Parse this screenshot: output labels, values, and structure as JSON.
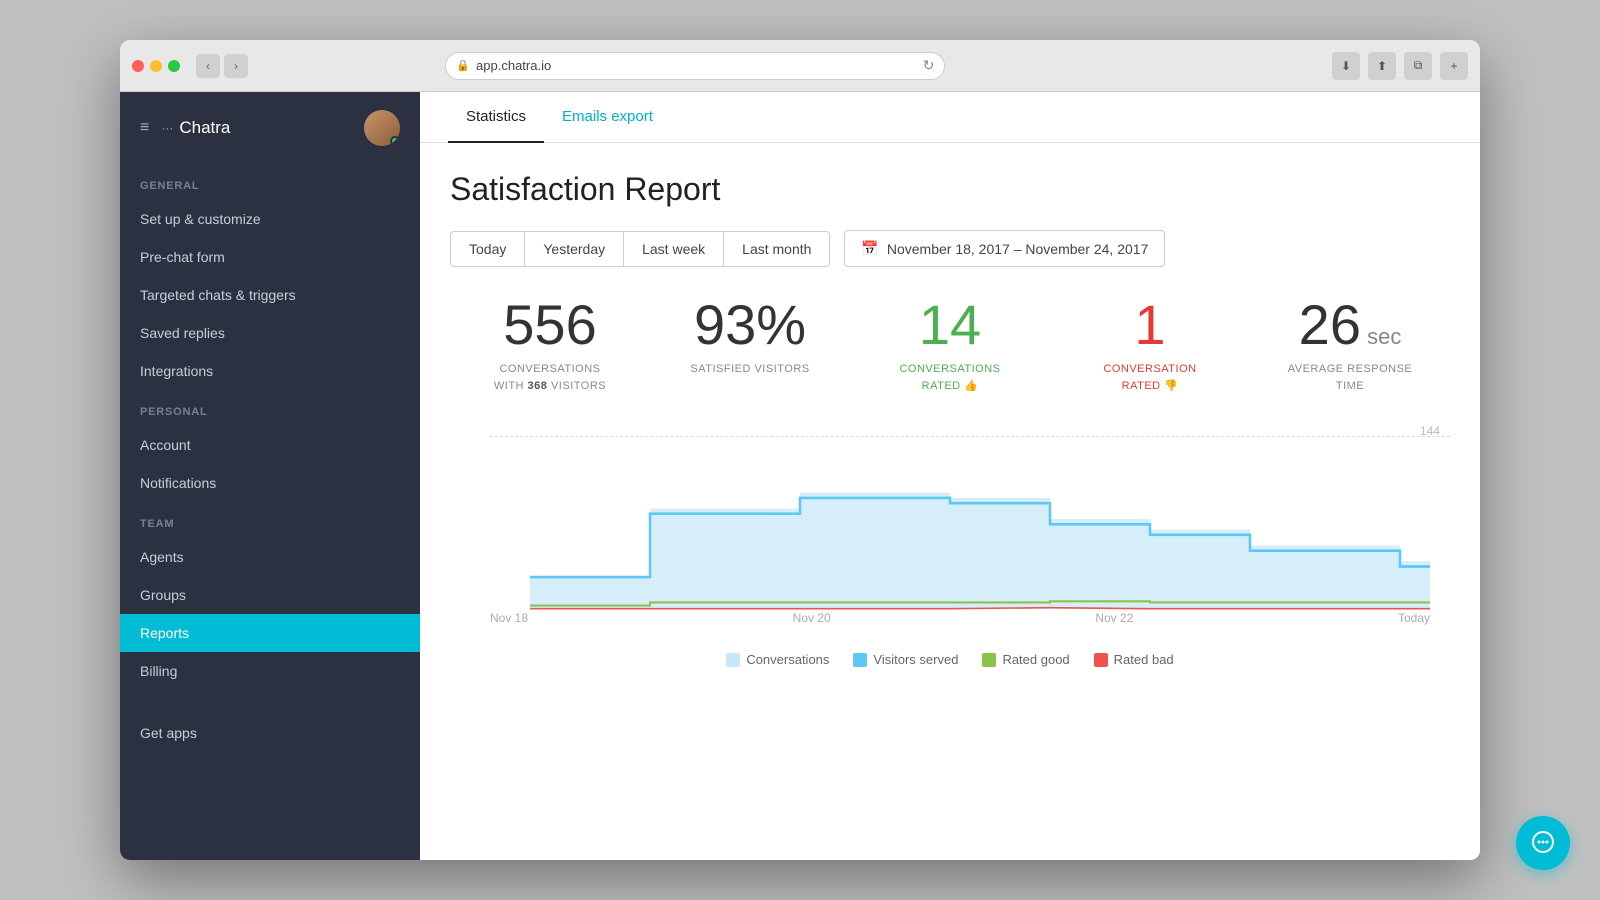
{
  "browser": {
    "url": "app.chatra.io",
    "reload_icon": "↻"
  },
  "sidebar": {
    "app_name": "Chatra",
    "sections": [
      {
        "label": "GENERAL",
        "items": [
          {
            "id": "setup",
            "label": "Set up & customize",
            "active": false
          },
          {
            "id": "pre-chat",
            "label": "Pre-chat form",
            "active": false
          },
          {
            "id": "targeted",
            "label": "Targeted chats & triggers",
            "active": false
          },
          {
            "id": "saved",
            "label": "Saved replies",
            "active": false
          },
          {
            "id": "integrations",
            "label": "Integrations",
            "active": false
          }
        ]
      },
      {
        "label": "PERSONAL",
        "items": [
          {
            "id": "account",
            "label": "Account",
            "active": false
          },
          {
            "id": "notifications",
            "label": "Notifications",
            "active": false
          }
        ]
      },
      {
        "label": "TEAM",
        "items": [
          {
            "id": "agents",
            "label": "Agents",
            "active": false
          },
          {
            "id": "groups",
            "label": "Groups",
            "active": false
          },
          {
            "id": "reports",
            "label": "Reports",
            "active": true
          },
          {
            "id": "billing",
            "label": "Billing",
            "active": false
          }
        ]
      }
    ],
    "bottom_items": [
      {
        "id": "get-apps",
        "label": "Get apps"
      }
    ]
  },
  "tabs": [
    {
      "id": "statistics",
      "label": "Statistics",
      "active": true
    },
    {
      "id": "emails-export",
      "label": "Emails export",
      "active": false
    }
  ],
  "page": {
    "title": "Satisfaction Report"
  },
  "filters": {
    "buttons": [
      "Today",
      "Yesterday",
      "Last week",
      "Last month"
    ],
    "date_range": "November 18, 2017 – November 24, 2017"
  },
  "stats": [
    {
      "id": "conversations",
      "number": "556",
      "color": "default",
      "label_line1": "CONVERSATIONS",
      "label_line2": "WITH",
      "bold_text": "368",
      "label_line3": "VISITORS"
    },
    {
      "id": "satisfied",
      "number": "93%",
      "color": "default",
      "label": "SATISFIED VISITORS"
    },
    {
      "id": "rated-good",
      "number": "14",
      "color": "green",
      "label_line1": "CONVERSATIONS",
      "label_line2": "RATED 👍"
    },
    {
      "id": "rated-bad",
      "number": "1",
      "color": "red",
      "label_line1": "CONVERSATION",
      "label_line2": "RATED 👎"
    },
    {
      "id": "response-time",
      "number": "26",
      "suffix": "sec",
      "color": "default",
      "label_line1": "AVERAGE RESPONSE",
      "label_line2": "TIME"
    }
  ],
  "chart": {
    "y_max_label": "144",
    "x_labels": [
      "Nov 18",
      "Nov 20",
      "Nov 22",
      "Today"
    ],
    "legend": [
      {
        "id": "conversations",
        "label": "Conversations",
        "color": "#c8e6f7"
      },
      {
        "id": "visitors-served",
        "label": "Visitors served",
        "color": "#5bc8f5"
      },
      {
        "id": "rated-good",
        "label": "Rated good",
        "color": "#8bc34a"
      },
      {
        "id": "rated-bad",
        "label": "Rated bad",
        "color": "#ef5350"
      }
    ]
  }
}
